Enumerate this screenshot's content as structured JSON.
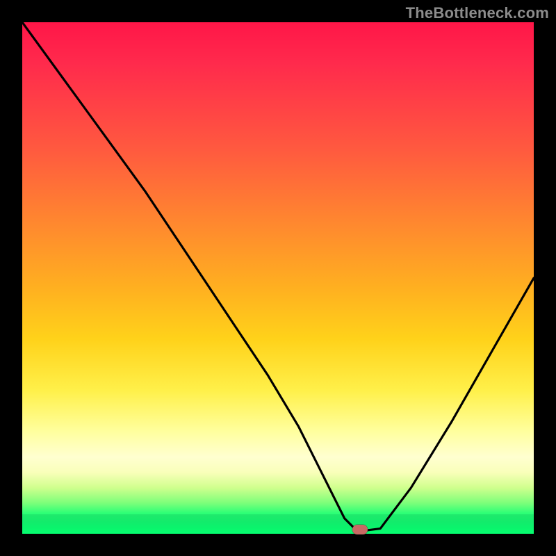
{
  "watermark": "TheBottleneck.com",
  "chart_data": {
    "type": "line",
    "title": "",
    "xlabel": "",
    "ylabel": "",
    "xlim": [
      0,
      100
    ],
    "ylim": [
      0,
      100
    ],
    "grid": false,
    "legend": false,
    "series": [
      {
        "name": "bottleneck-curve",
        "x": [
          0,
          8,
          16,
          24,
          30,
          36,
          42,
          48,
          54,
          58,
          61,
          63,
          65,
          66,
          70,
          76,
          84,
          92,
          100
        ],
        "values": [
          100,
          89,
          78,
          67,
          58,
          49,
          40,
          31,
          21,
          13,
          7,
          3,
          1,
          0.5,
          1,
          9,
          22,
          36,
          50
        ]
      }
    ],
    "marker": {
      "x": 66,
      "y": 0.5,
      "shape": "rounded-rect",
      "color": "#c86a64"
    },
    "background": "red-yellow-green-vertical-gradient"
  }
}
